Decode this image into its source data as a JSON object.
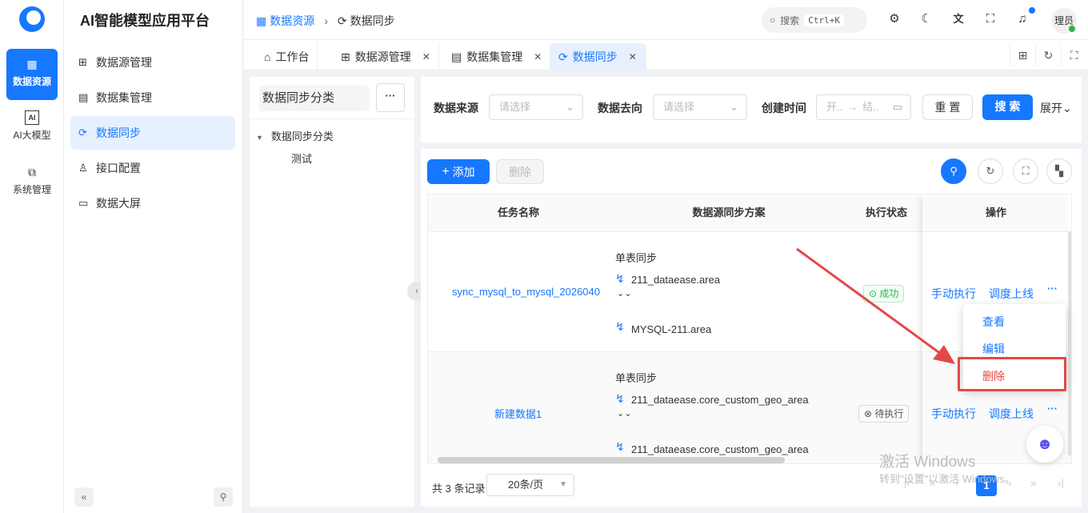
{
  "rail": {
    "items": [
      {
        "label": "数据资源",
        "icon": "database-icon"
      },
      {
        "label": "AI大模型",
        "icon": "ai-icon"
      },
      {
        "label": "系统管理",
        "icon": "system-icon"
      }
    ]
  },
  "app_title": "AI智能模型应用平台",
  "menu": {
    "items": [
      {
        "label": "数据源管理"
      },
      {
        "label": "数据集管理"
      },
      {
        "label": "数据同步"
      },
      {
        "label": "接口配置"
      },
      {
        "label": "数据大屏"
      }
    ]
  },
  "breadcrumb": {
    "first": "数据资源",
    "second": "数据同步"
  },
  "search": {
    "placeholder": "搜索",
    "shortcut": "Ctrl+K"
  },
  "user": {
    "avatar": "理员"
  },
  "tabs": [
    {
      "label": "工作台"
    },
    {
      "label": "数据源管理"
    },
    {
      "label": "数据集管理"
    },
    {
      "label": "数据同步"
    }
  ],
  "tree": {
    "title": "数据同步分类",
    "more": "···",
    "root": "数据同步分类",
    "child": "测试"
  },
  "filter": {
    "source_label": "数据来源",
    "source_placeholder": "请选择",
    "target_label": "数据去向",
    "target_placeholder": "请选择",
    "time_label": "创建时间",
    "time_start": "开..",
    "time_end": "结..",
    "reset": "重 置",
    "search": "搜 索",
    "expand": "展开"
  },
  "toolbar": {
    "add": "添加",
    "delete": "删除"
  },
  "table": {
    "headers": [
      "任务名称",
      "数据源同步方案",
      "执行状态",
      "操作"
    ],
    "rows": [
      {
        "name": "sync_mysql_to_mysql_2026040",
        "mode": "单表同步",
        "source": "211_dataease.area",
        "target": "MYSQL-211.area",
        "status": "成功",
        "op1": "手动执行",
        "op2": "调度上线",
        "more": "···"
      },
      {
        "name": "新建数据1",
        "mode": "单表同步",
        "source": "211_dataease.core_custom_geo_area",
        "target": "211_dataease.core_custom_geo_area",
        "status": "待执行",
        "op1": "手动执行",
        "op2": "调度上线",
        "more": "···"
      }
    ]
  },
  "dropdown": {
    "view": "查看",
    "edit": "编辑",
    "delete": "删除"
  },
  "pagination": {
    "total": "共 3 条记录",
    "page_size": "20条/页",
    "current": "1"
  },
  "watermark": {
    "line1": "激活 Windows",
    "line2": "转到\"设置\"以激活 Windows。"
  },
  "colors": {
    "primary": "#1677ff",
    "danger": "#e34848",
    "success": "#2fb352"
  }
}
